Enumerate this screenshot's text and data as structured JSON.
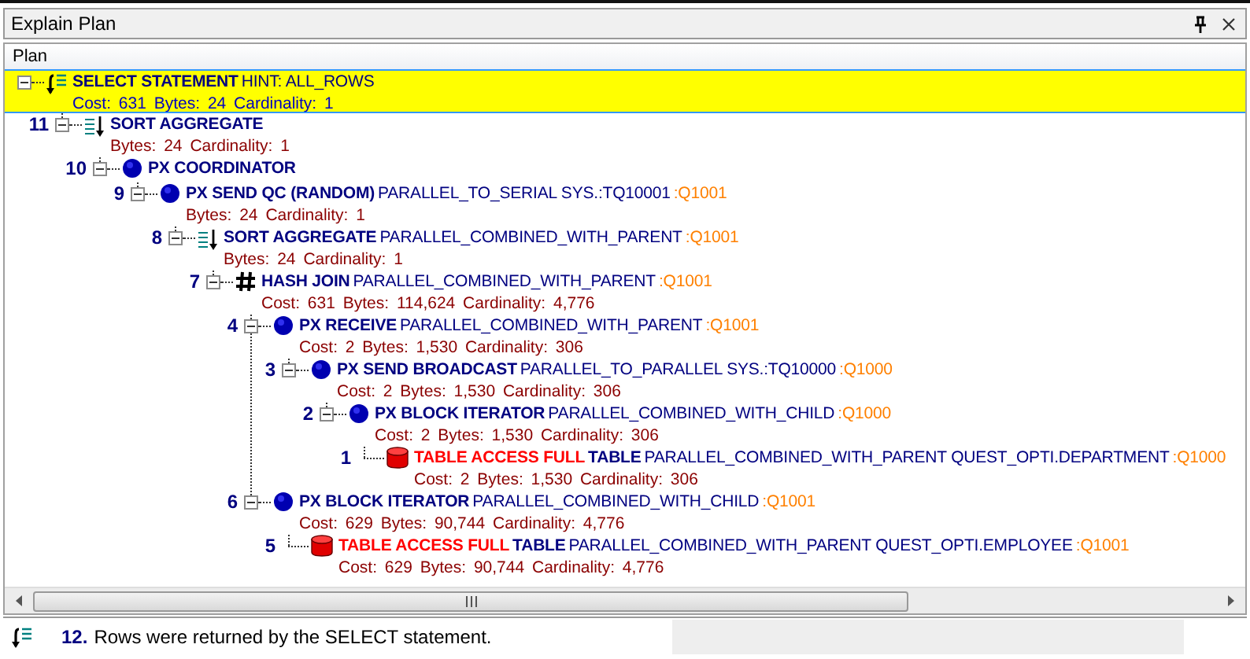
{
  "window": {
    "title": "Explain Plan"
  },
  "header": {
    "label": "Plan"
  },
  "plan": {
    "kind": "select",
    "operation": "SELECT STATEMENT",
    "options": "HINT: ALL_ROWS",
    "stats": "Cost: 631 Bytes: 24 Cardinality: 1",
    "selected": true,
    "expanded": true,
    "children": [
      {
        "kind": "sort",
        "number": "11",
        "operation": "SORT AGGREGATE",
        "stats": "Bytes: 24 Cardinality: 1",
        "selected": false,
        "expanded": true,
        "children": [
          {
            "kind": "px",
            "number": "10",
            "operation": "PX COORDINATOR",
            "selected": false,
            "expanded": true,
            "children": [
              {
                "kind": "px",
                "number": "9",
                "operation": "PX SEND QC (RANDOM)",
                "options": "PARALLEL_TO_SERIAL SYS.:TQ10001",
                "queue": ":Q1001",
                "stats": "Bytes: 24 Cardinality: 1",
                "selected": false,
                "expanded": true,
                "children": [
                  {
                    "kind": "sort",
                    "number": "8",
                    "operation": "SORT AGGREGATE",
                    "options": "PARALLEL_COMBINED_WITH_PARENT",
                    "queue": ":Q1001",
                    "stats": "Bytes: 24 Cardinality: 1",
                    "selected": false,
                    "expanded": true,
                    "children": [
                      {
                        "kind": "hash",
                        "number": "7",
                        "operation": "HASH JOIN",
                        "options": "PARALLEL_COMBINED_WITH_PARENT",
                        "queue": ":Q1001",
                        "stats": "Cost: 631 Bytes: 114,624 Cardinality: 4,776",
                        "selected": false,
                        "expanded": true,
                        "children": [
                          {
                            "kind": "px",
                            "number": "4",
                            "operation": "PX RECEIVE",
                            "options": "PARALLEL_COMBINED_WITH_PARENT",
                            "queue": ":Q1001",
                            "stats": "Cost: 2 Bytes: 1,530 Cardinality: 306",
                            "selected": false,
                            "expanded": true,
                            "children": [
                              {
                                "kind": "px",
                                "number": "3",
                                "operation": "PX SEND BROADCAST",
                                "options": "PARALLEL_TO_PARALLEL SYS.:TQ10000",
                                "queue": ":Q1000",
                                "stats": "Cost: 2 Bytes: 1,530 Cardinality: 306",
                                "selected": false,
                                "expanded": true,
                                "children": [
                                  {
                                    "kind": "px",
                                    "number": "2",
                                    "operation": "PX BLOCK ITERATOR",
                                    "options": "PARALLEL_COMBINED_WITH_CHILD",
                                    "queue": ":Q1000",
                                    "stats": "Cost: 2 Bytes: 1,530 Cardinality: 306",
                                    "selected": false,
                                    "expanded": true,
                                    "children": [
                                      {
                                        "kind": "table",
                                        "number": "1",
                                        "operation": "TABLE ACCESS FULL",
                                        "object_type": "TABLE",
                                        "options": "PARALLEL_COMBINED_WITH_PARENT QUEST_OPTI.DEPARTMENT",
                                        "queue": ":Q1000",
                                        "stats": "Cost: 2 Bytes: 1,530 Cardinality: 306",
                                        "selected": false
                                      }
                                    ]
                                  }
                                ]
                              }
                            ]
                          },
                          {
                            "kind": "px",
                            "number": "6",
                            "operation": "PX BLOCK ITERATOR",
                            "options": "PARALLEL_COMBINED_WITH_CHILD",
                            "queue": ":Q1001",
                            "stats": "Cost: 629 Bytes: 90,744 Cardinality: 4,776",
                            "selected": false,
                            "expanded": true,
                            "children": [
                              {
                                "kind": "table",
                                "number": "5",
                                "operation": "TABLE ACCESS FULL",
                                "object_type": "TABLE",
                                "options": "PARALLEL_COMBINED_WITH_PARENT QUEST_OPTI.EMPLOYEE",
                                "queue": ":Q1001",
                                "stats": "Cost: 629 Bytes: 90,744 Cardinality: 4,776",
                                "selected": false
                              }
                            ]
                          }
                        ]
                      }
                    ]
                  }
                ]
              }
            ]
          }
        ]
      }
    ]
  },
  "status_bar": {
    "count": "12.",
    "message": "Rows were returned by the SELECT statement."
  }
}
